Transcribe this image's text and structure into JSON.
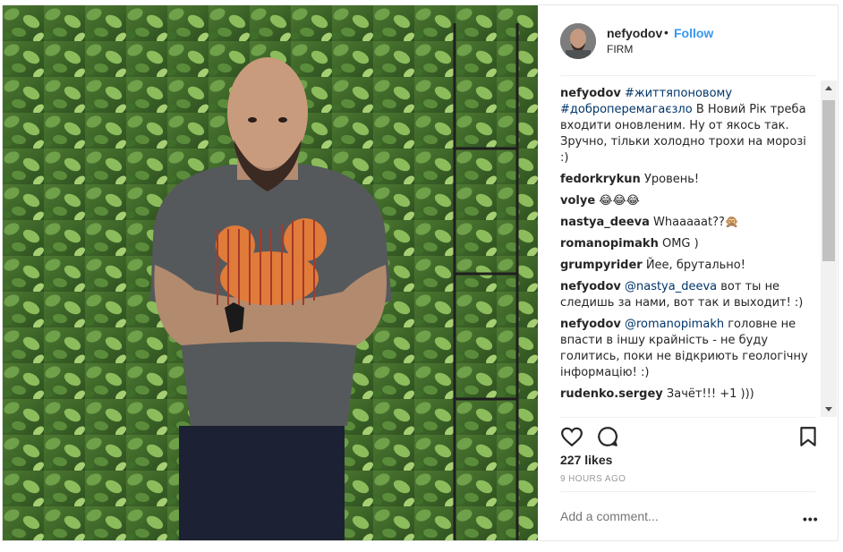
{
  "post": {
    "username": "nefyodov",
    "separator": "•",
    "follow_label": "Follow",
    "location": "FIRM",
    "likes": "227 likes",
    "timestamp": "9 HOURS AGO",
    "comment_placeholder": "Add a comment...",
    "more_label": "•••",
    "photo_description": "man-with-crossed-arms-before-plant-wall"
  },
  "caption": {
    "user": "nefyodov",
    "hashtags": [
      "#життяпоновому",
      "#доброперемагаєзло"
    ],
    "text": " В Новий Рік треба входити оновленим. Ну от якось так. Зручно, тільки холодно трохи на морозі :)"
  },
  "comments": [
    {
      "user": "fedorkrykun",
      "mention": "",
      "text": " Уровень!"
    },
    {
      "user": "volye",
      "mention": "",
      "text": " 😂😂😂"
    },
    {
      "user": "nastya_deeva",
      "mention": "",
      "text": " Whaaaaat??🙊"
    },
    {
      "user": "romanopimakh",
      "mention": "",
      "text": " OMG )"
    },
    {
      "user": "grumpyrider",
      "mention": "",
      "text": " Йее, брутально!"
    },
    {
      "user": "nefyodov",
      "mention": "@nastya_deeva",
      "text": " вот ты не следишь за нами, вот так и выходит! :)"
    },
    {
      "user": "nefyodov",
      "mention": "@romanopimakh",
      "text": " головне не впасти в іншу крайність - не буду голитись, поки не відкриють геологічну інформацію! :)"
    },
    {
      "user": "rudenko.sergey",
      "mention": "",
      "text": " Зачёт!!! +1 )))"
    }
  ],
  "icons": {
    "like": "heart-icon",
    "comment": "comment-bubble-icon",
    "save": "bookmark-icon"
  },
  "colors": {
    "link": "#3897f0",
    "hashtag": "#003569",
    "text": "#262626",
    "muted": "#999999"
  }
}
